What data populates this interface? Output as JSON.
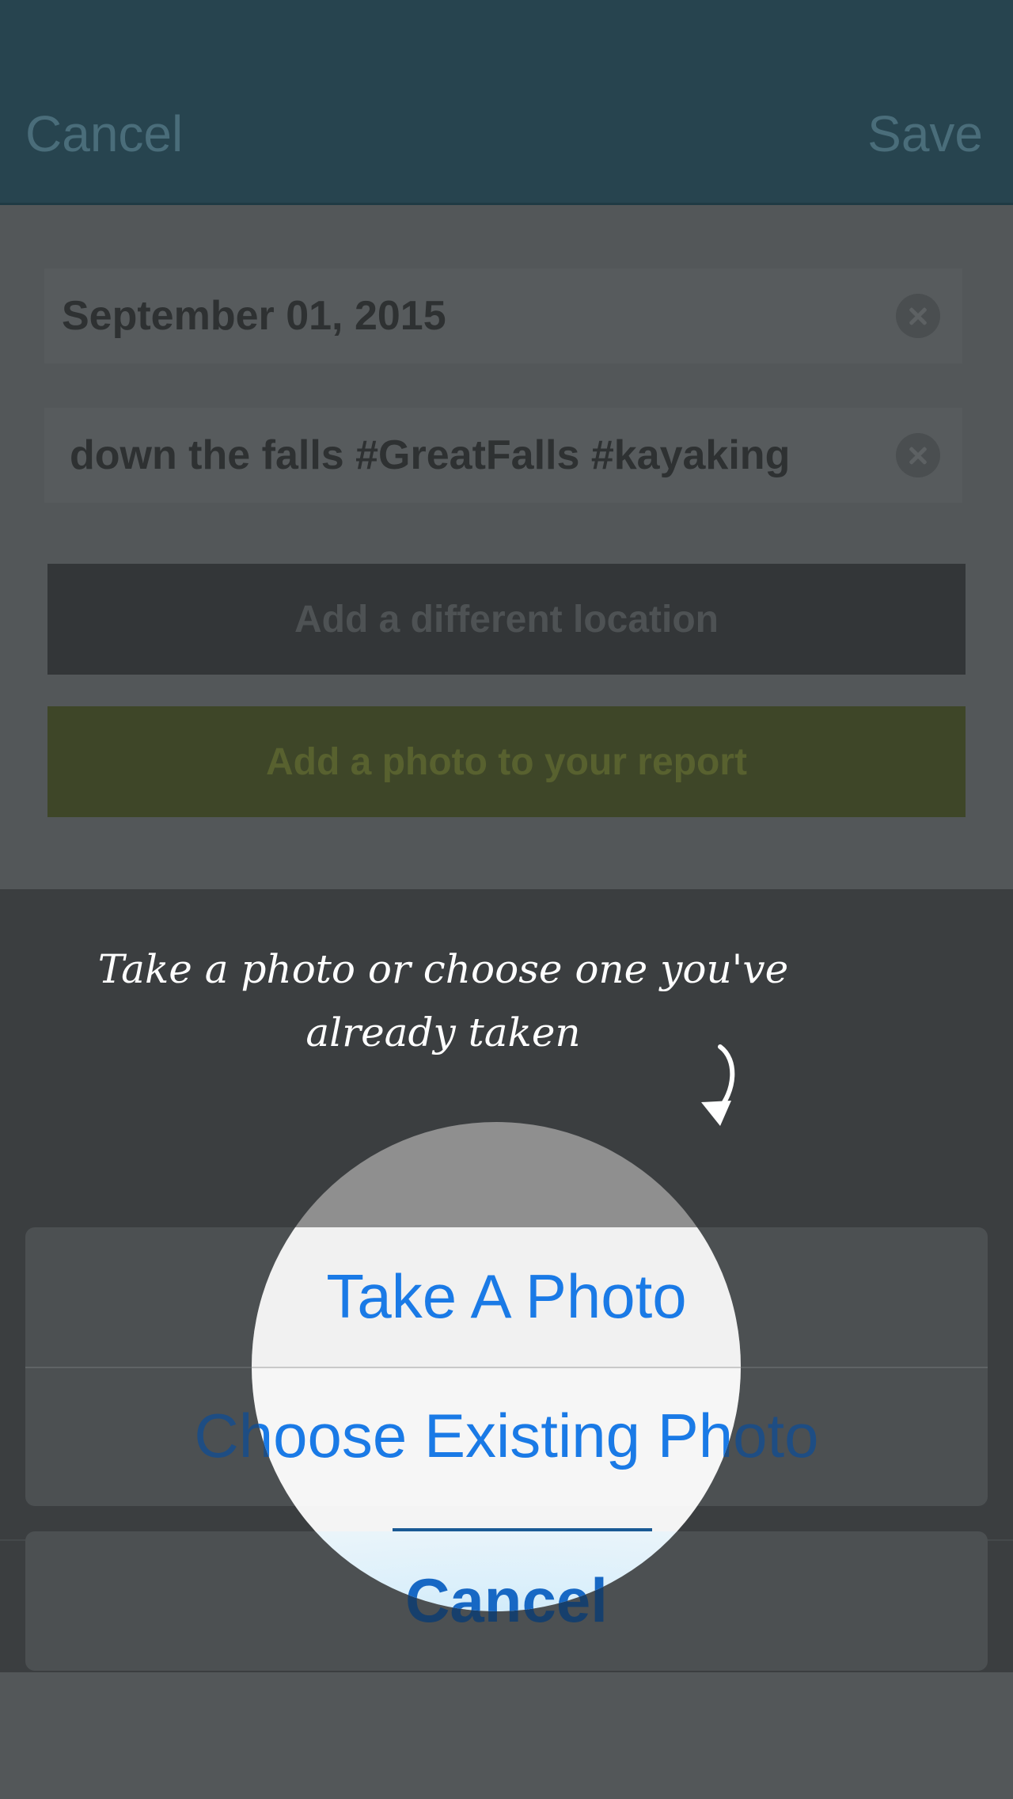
{
  "header": {
    "cancel_label": "Cancel",
    "save_label": "Save"
  },
  "form": {
    "date_value": "September 01, 2015",
    "description_value": "down the falls #GreatFalls #kayaking",
    "location_button_label": "Add a different location",
    "photo_button_label": "Add a photo to your report"
  },
  "tip": {
    "text": "Take a photo or choose one you've already taken"
  },
  "action_sheet": {
    "options": [
      {
        "label": "Take A Photo"
      },
      {
        "label": "Choose Existing Photo"
      }
    ],
    "cancel_label": "Cancel"
  },
  "colors": {
    "header_bg": "#27444f",
    "photo_button_bg": "#3e4628",
    "location_button_bg": "#333638",
    "ios_blue": "#1a7ae6"
  },
  "icons": {
    "clear": "clear-circle-icon",
    "tip_arrow": "curved-arrow-down-icon"
  }
}
